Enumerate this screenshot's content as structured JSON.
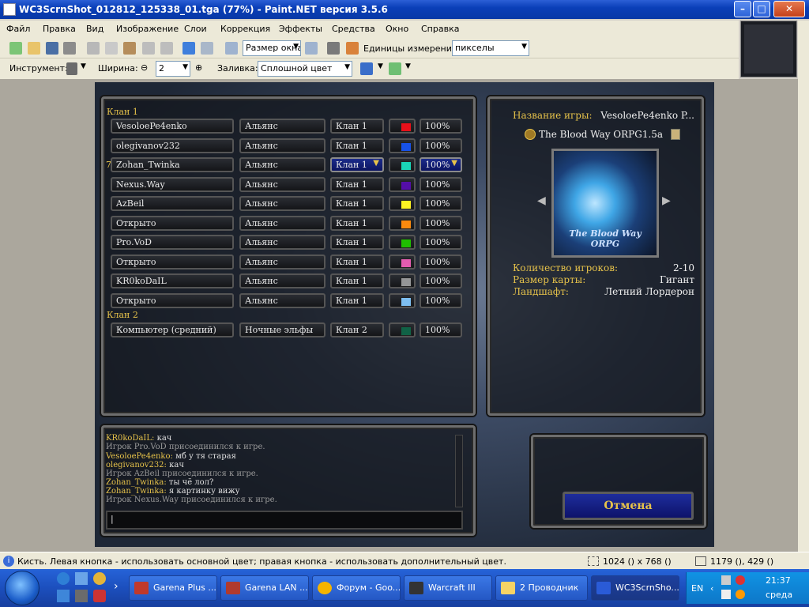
{
  "window": {
    "title": "WC3ScrnShot_012812_125338_01.tga (77%) - Paint.NET версия 3.5.6",
    "minimize": "–",
    "maximize": "□",
    "close": "✕"
  },
  "menu": [
    "Файл",
    "Правка",
    "Вид",
    "Изображение",
    "Слои",
    "Коррекция",
    "Эффекты",
    "Средства",
    "Окно",
    "Справка"
  ],
  "toolbar1": {
    "zoom_value": "Размер окна",
    "units_label": "Единицы измерения:",
    "units_value": "пикселы"
  },
  "toolbar2": {
    "tool_label": "Инструмент:",
    "width_label": "Ширина:",
    "width_value": "2",
    "fill_label": "Заливка:",
    "fill_value": "Сплошной цвет"
  },
  "game": {
    "clan1_label": "Клан 1",
    "clan2_label": "Клан 2",
    "row_marker": "7",
    "players": [
      {
        "name": "VesoloePe4enko",
        "race": "Альянс",
        "team": "Клан 1",
        "color": "#e8101a",
        "handicap": "100%",
        "selected": false
      },
      {
        "name": "olegivanov232",
        "race": "Альянс",
        "team": "Клан 1",
        "color": "#1752e8",
        "handicap": "100%",
        "selected": false
      },
      {
        "name": "Zohan_Twinka",
        "race": "Альянс",
        "team": "Клан 1",
        "color": "#1ad5b8",
        "handicap": "100%",
        "selected": true
      },
      {
        "name": "Nexus.Way",
        "race": "Альянс",
        "team": "Клан 1",
        "color": "#540ea8",
        "handicap": "100%",
        "selected": false
      },
      {
        "name": "AzBeil",
        "race": "Альянс",
        "team": "Клан 1",
        "color": "#fdf322",
        "handicap": "100%",
        "selected": false
      },
      {
        "name": "Открыто",
        "race": "Альянс",
        "team": "Клан 1",
        "color": "#fa8a0e",
        "handicap": "100%",
        "selected": false
      },
      {
        "name": "Pro.VoD",
        "race": "Альянс",
        "team": "Клан 1",
        "color": "#1fbf00",
        "handicap": "100%",
        "selected": false
      },
      {
        "name": "Открыто",
        "race": "Альянс",
        "team": "Клан 1",
        "color": "#e45cb0",
        "handicap": "100%",
        "selected": false
      },
      {
        "name": "KR0koDaIL",
        "race": "Альянс",
        "team": "Клан 1",
        "color": "#959697",
        "handicap": "100%",
        "selected": false
      },
      {
        "name": "Открыто",
        "race": "Альянс",
        "team": "Клан 1",
        "color": "#7ebff1",
        "handicap": "100%",
        "selected": false
      }
    ],
    "clan2_players": [
      {
        "name": "Компьютер (средний)",
        "race": "Ночные эльфы",
        "team": "Клан 2",
        "color": "#106246",
        "handicap": "100%"
      }
    ],
    "info": {
      "game_name_label": "Название игры:",
      "game_name_value": "VesoloePe4enko P...",
      "map_title": "The Blood Way ORPG1.5a",
      "map_preview_text": "The Blood Way ORPG",
      "players_label": "Количество игроков:",
      "players_value": "2-10",
      "size_label": "Размер карты:",
      "size_value": "Гигант",
      "tileset_label": "Ландшафт:",
      "tileset_value": "Летний Лордерон"
    },
    "chat": [
      {
        "name": "KR0koDaIL:",
        "text": "кач"
      },
      {
        "name": "",
        "text": "Игрок Pro.VoD присоединился к игре."
      },
      {
        "name": "VesoloePe4enko:",
        "text": "мб у тя старая"
      },
      {
        "name": "olegivanov232:",
        "text": "кач"
      },
      {
        "name": "",
        "text": "Игрок AzBeil присоединился к игре."
      },
      {
        "name": "Zohan_Twinka:",
        "text": "ты чё лол?"
      },
      {
        "name": "Zohan_Twinka:",
        "text": "я картинку вижу"
      },
      {
        "name": "",
        "text": "Игрок Nexus.Way присоединился к игре."
      }
    ],
    "cancel": "Отмена"
  },
  "status": {
    "hint": "Кисть. Левая кнопка - использовать основной цвет; правая кнопка - использовать дополнительный цвет.",
    "size": "1024 () x 768 ()",
    "pos": "1179 (), 429 ()"
  },
  "taskbar": {
    "tasks": [
      {
        "label": "Garena Plus ...",
        "icon": "#c0392b"
      },
      {
        "label": "Garena LAN ...",
        "icon": "#b03a2e"
      },
      {
        "label": "Форум - Goo...",
        "icon": "#f4b400"
      },
      {
        "label": "Warcraft III",
        "icon": "#333333"
      },
      {
        "label": "2 Проводник",
        "icon": "#f6d365"
      },
      {
        "label": "WC3ScrnSho...",
        "icon": "#2a5bd7"
      }
    ],
    "lang": "EN",
    "time": "21:37",
    "day": "среда"
  }
}
